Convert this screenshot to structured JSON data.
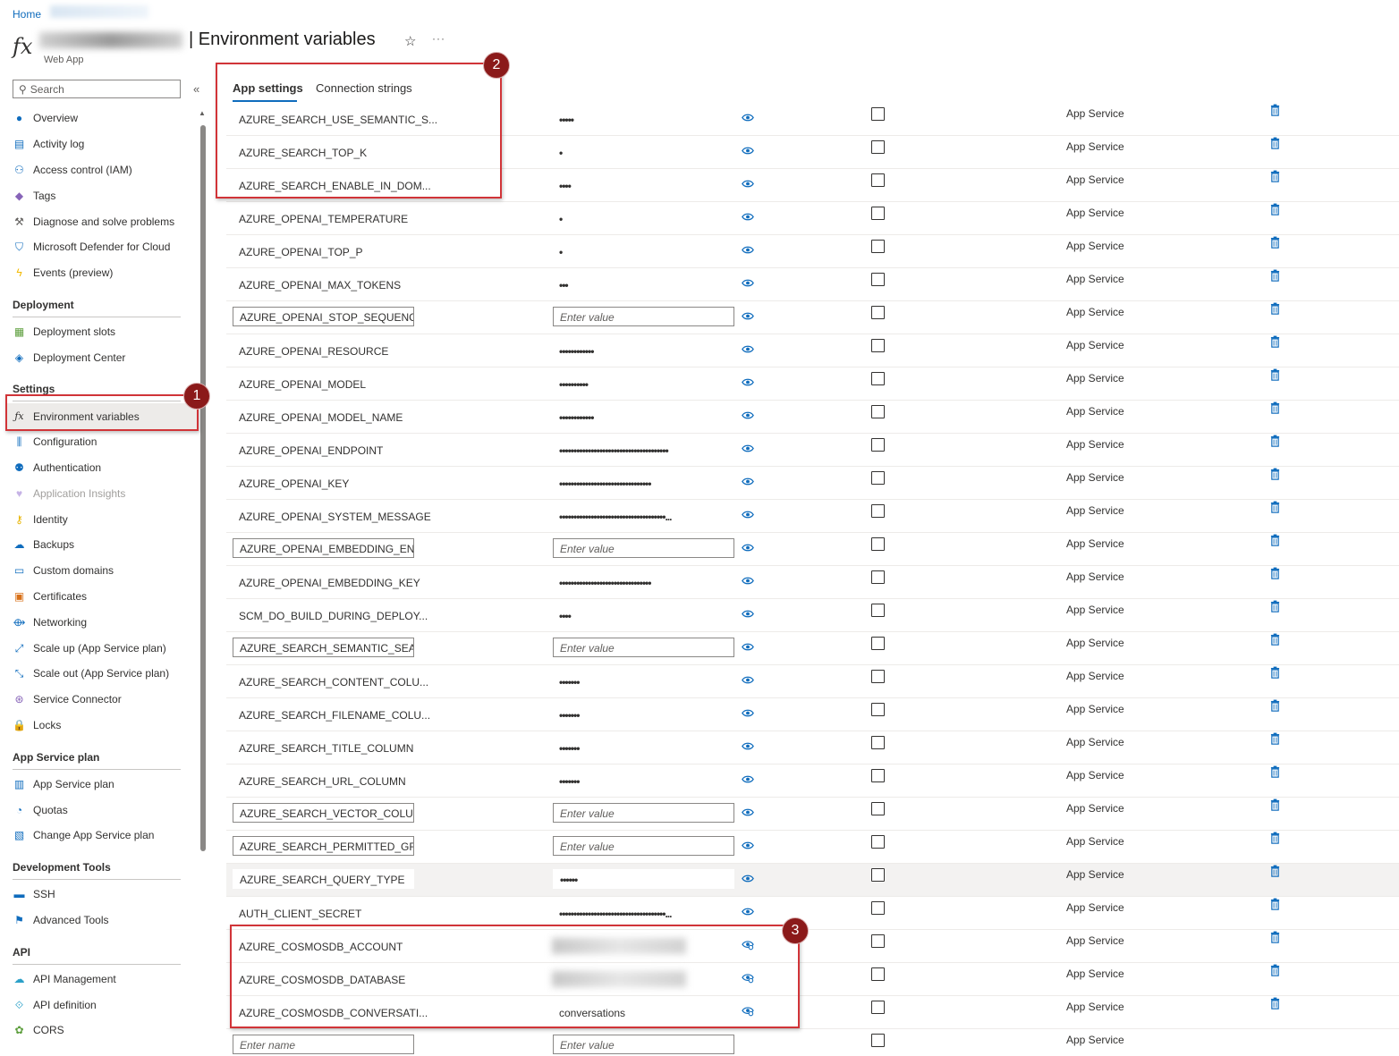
{
  "breadcrumb": {
    "home": "Home"
  },
  "header": {
    "title": "| Environment variables",
    "subtitle": "Web App",
    "favorite_icon": "star-icon",
    "more": "···"
  },
  "sidebar": {
    "search_placeholder": "Search",
    "collapse": "«",
    "top_items": [
      {
        "label": "Overview",
        "icon": "globe-icon"
      },
      {
        "label": "Activity log",
        "icon": "log-icon"
      },
      {
        "label": "Access control (IAM)",
        "icon": "people-icon"
      },
      {
        "label": "Tags",
        "icon": "tag-icon"
      },
      {
        "label": "Diagnose and solve problems",
        "icon": "wrench-icon"
      },
      {
        "label": "Microsoft Defender for Cloud",
        "icon": "shield-icon"
      },
      {
        "label": "Events (preview)",
        "icon": "bolt-icon"
      }
    ],
    "sections": [
      {
        "title": "Deployment",
        "items": [
          {
            "label": "Deployment slots",
            "icon": "slots-icon"
          },
          {
            "label": "Deployment Center",
            "icon": "cube-icon"
          }
        ]
      },
      {
        "title": "Settings",
        "items": [
          {
            "label": "Environment variables",
            "icon": "fx-icon",
            "selected": true
          },
          {
            "label": "Configuration",
            "icon": "sliders-icon"
          },
          {
            "label": "Authentication",
            "icon": "user-key-icon"
          },
          {
            "label": "Application Insights",
            "icon": "bulb-icon",
            "disabled": true
          },
          {
            "label": "Identity",
            "icon": "key-icon"
          },
          {
            "label": "Backups",
            "icon": "cloud-icon"
          },
          {
            "label": "Custom domains",
            "icon": "domain-icon"
          },
          {
            "label": "Certificates",
            "icon": "certificate-icon"
          },
          {
            "label": "Networking",
            "icon": "network-icon"
          },
          {
            "label": "Scale up (App Service plan)",
            "icon": "scale-up-icon"
          },
          {
            "label": "Scale out (App Service plan)",
            "icon": "scale-out-icon"
          },
          {
            "label": "Service Connector",
            "icon": "connector-icon"
          },
          {
            "label": "Locks",
            "icon": "lock-icon"
          }
        ]
      },
      {
        "title": "App Service plan",
        "items": [
          {
            "label": "App Service plan",
            "icon": "plan-icon"
          },
          {
            "label": "Quotas",
            "icon": "gauge-icon"
          },
          {
            "label": "Change App Service plan",
            "icon": "change-plan-icon"
          }
        ]
      },
      {
        "title": "Development Tools",
        "items": [
          {
            "label": "SSH",
            "icon": "terminal-icon"
          },
          {
            "label": "Advanced Tools",
            "icon": "tools-icon"
          }
        ]
      },
      {
        "title": "API",
        "items": [
          {
            "label": "API Management",
            "icon": "api-cloud-icon"
          },
          {
            "label": "API definition",
            "icon": "api-def-icon"
          },
          {
            "label": "CORS",
            "icon": "cors-icon"
          }
        ]
      }
    ]
  },
  "tabs": [
    {
      "label": "App settings",
      "active": true
    },
    {
      "label": "Connection strings",
      "active": false
    }
  ],
  "source_label": "App Service",
  "settings": [
    {
      "name": "AZURE_SEARCH_USE_SEMANTIC_S...",
      "value": "•••••",
      "mode": "text"
    },
    {
      "name": "AZURE_SEARCH_TOP_K",
      "value": "•",
      "mode": "text"
    },
    {
      "name": "AZURE_SEARCH_ENABLE_IN_DOM...",
      "value": "••••",
      "mode": "text"
    },
    {
      "name": "AZURE_OPENAI_TEMPERATURE",
      "value": "•",
      "mode": "text"
    },
    {
      "name": "AZURE_OPENAI_TOP_P",
      "value": "•",
      "mode": "text"
    },
    {
      "name": "AZURE_OPENAI_MAX_TOKENS",
      "value": "•••",
      "mode": "text"
    },
    {
      "name": "AZURE_OPENAI_STOP_SEQUENCE",
      "value": "Enter value",
      "mode": "input"
    },
    {
      "name": "AZURE_OPENAI_RESOURCE",
      "value": "••••••••••••",
      "mode": "text"
    },
    {
      "name": "AZURE_OPENAI_MODEL",
      "value": "••••••••••",
      "mode": "text"
    },
    {
      "name": "AZURE_OPENAI_MODEL_NAME",
      "value": "••••••••••••",
      "mode": "text"
    },
    {
      "name": "AZURE_OPENAI_ENDPOINT",
      "value": "••••••••••••••••••••••••••••••••••••••",
      "mode": "text"
    },
    {
      "name": "AZURE_OPENAI_KEY",
      "value": "••••••••••••••••••••••••••••••••",
      "mode": "text"
    },
    {
      "name": "AZURE_OPENAI_SYSTEM_MESSAGE",
      "value": "•••••••••••••••••••••••••••••••••••••...",
      "mode": "text"
    },
    {
      "name": "AZURE_OPENAI_EMBEDDING_EN...",
      "value": "Enter value",
      "mode": "input"
    },
    {
      "name": "AZURE_OPENAI_EMBEDDING_KEY",
      "value": "••••••••••••••••••••••••••••••••",
      "mode": "text"
    },
    {
      "name": "SCM_DO_BUILD_DURING_DEPLOY...",
      "value": "••••",
      "mode": "text"
    },
    {
      "name": "AZURE_SEARCH_SEMANTIC_SEAR...",
      "value": "Enter value",
      "mode": "input"
    },
    {
      "name": "AZURE_SEARCH_CONTENT_COLU...",
      "value": "•••••••",
      "mode": "text"
    },
    {
      "name": "AZURE_SEARCH_FILENAME_COLU...",
      "value": "•••••••",
      "mode": "text"
    },
    {
      "name": "AZURE_SEARCH_TITLE_COLUMN",
      "value": "•••••••",
      "mode": "text"
    },
    {
      "name": "AZURE_SEARCH_URL_COLUMN",
      "value": "•••••••",
      "mode": "text"
    },
    {
      "name": "AZURE_SEARCH_VECTOR_COLUM...",
      "value": "Enter value",
      "mode": "input"
    },
    {
      "name": "AZURE_SEARCH_PERMITTED_GRO...",
      "value": "Enter value",
      "mode": "input"
    },
    {
      "name": "AZURE_SEARCH_QUERY_TYPE",
      "value": "••••••",
      "mode": "hover"
    },
    {
      "name": "AUTH_CLIENT_SECRET",
      "value": "•••••••••••••••••••••••••••••••••••••...",
      "mode": "text"
    },
    {
      "name": "AZURE_COSMOSDB_ACCOUNT",
      "value": "",
      "mode": "blurred"
    },
    {
      "name": "AZURE_COSMOSDB_DATABASE",
      "value": "",
      "mode": "blurred"
    },
    {
      "name": "AZURE_COSMOSDB_CONVERSATI...",
      "value": "conversations",
      "mode": "shown"
    }
  ],
  "new_row": {
    "name_placeholder": "Enter name",
    "value_placeholder": "Enter value"
  },
  "annotations": [
    "1",
    "2",
    "3"
  ],
  "colors": {
    "accent": "#0f6cbd",
    "highlight": "#d13438",
    "badge": "#8b1a1a"
  }
}
